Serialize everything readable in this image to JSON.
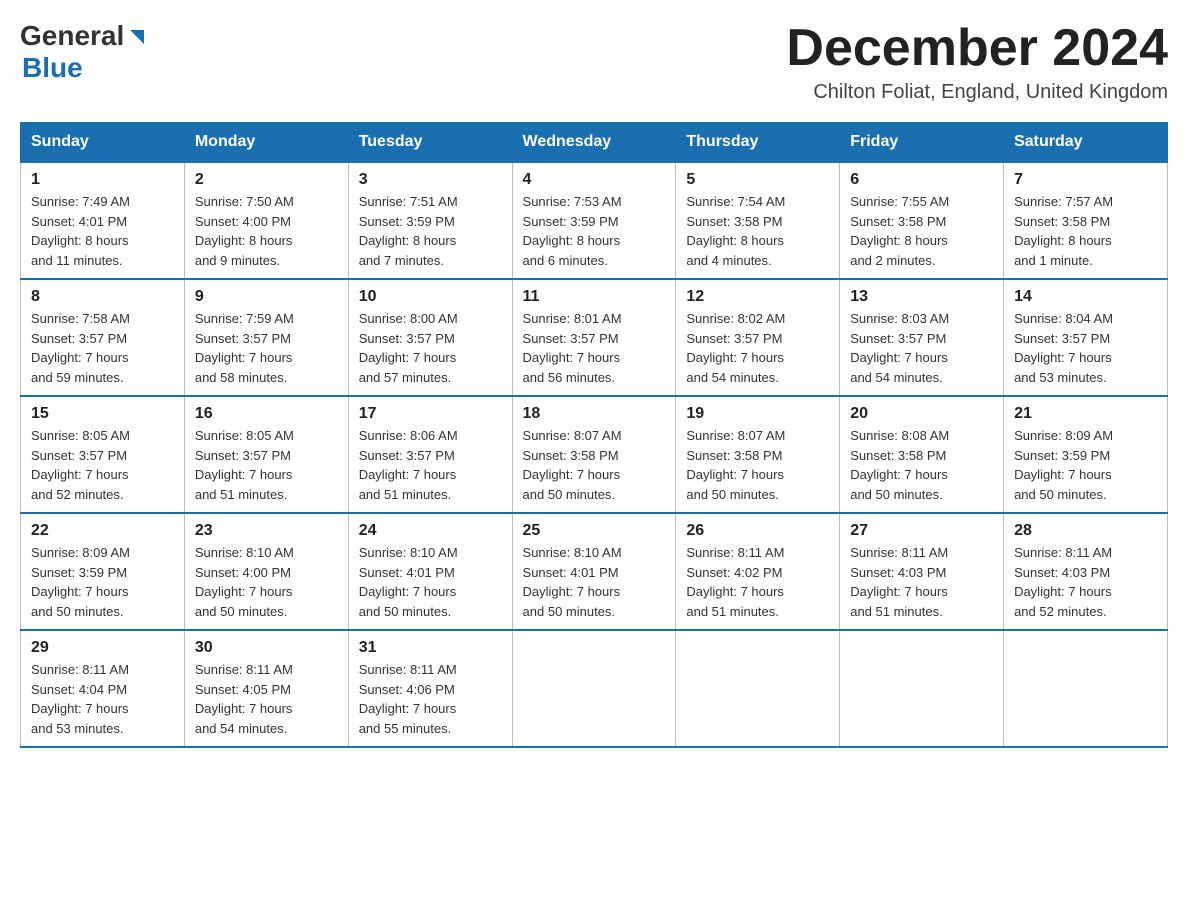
{
  "header": {
    "logo_general": "General",
    "logo_blue": "Blue",
    "month_title": "December 2024",
    "location": "Chilton Foliat, England, United Kingdom"
  },
  "weekdays": [
    "Sunday",
    "Monday",
    "Tuesday",
    "Wednesday",
    "Thursday",
    "Friday",
    "Saturday"
  ],
  "weeks": [
    [
      {
        "day": "1",
        "sunrise": "Sunrise: 7:49 AM",
        "sunset": "Sunset: 4:01 PM",
        "daylight": "Daylight: 8 hours",
        "daylight2": "and 11 minutes."
      },
      {
        "day": "2",
        "sunrise": "Sunrise: 7:50 AM",
        "sunset": "Sunset: 4:00 PM",
        "daylight": "Daylight: 8 hours",
        "daylight2": "and 9 minutes."
      },
      {
        "day": "3",
        "sunrise": "Sunrise: 7:51 AM",
        "sunset": "Sunset: 3:59 PM",
        "daylight": "Daylight: 8 hours",
        "daylight2": "and 7 minutes."
      },
      {
        "day": "4",
        "sunrise": "Sunrise: 7:53 AM",
        "sunset": "Sunset: 3:59 PM",
        "daylight": "Daylight: 8 hours",
        "daylight2": "and 6 minutes."
      },
      {
        "day": "5",
        "sunrise": "Sunrise: 7:54 AM",
        "sunset": "Sunset: 3:58 PM",
        "daylight": "Daylight: 8 hours",
        "daylight2": "and 4 minutes."
      },
      {
        "day": "6",
        "sunrise": "Sunrise: 7:55 AM",
        "sunset": "Sunset: 3:58 PM",
        "daylight": "Daylight: 8 hours",
        "daylight2": "and 2 minutes."
      },
      {
        "day": "7",
        "sunrise": "Sunrise: 7:57 AM",
        "sunset": "Sunset: 3:58 PM",
        "daylight": "Daylight: 8 hours",
        "daylight2": "and 1 minute."
      }
    ],
    [
      {
        "day": "8",
        "sunrise": "Sunrise: 7:58 AM",
        "sunset": "Sunset: 3:57 PM",
        "daylight": "Daylight: 7 hours",
        "daylight2": "and 59 minutes."
      },
      {
        "day": "9",
        "sunrise": "Sunrise: 7:59 AM",
        "sunset": "Sunset: 3:57 PM",
        "daylight": "Daylight: 7 hours",
        "daylight2": "and 58 minutes."
      },
      {
        "day": "10",
        "sunrise": "Sunrise: 8:00 AM",
        "sunset": "Sunset: 3:57 PM",
        "daylight": "Daylight: 7 hours",
        "daylight2": "and 57 minutes."
      },
      {
        "day": "11",
        "sunrise": "Sunrise: 8:01 AM",
        "sunset": "Sunset: 3:57 PM",
        "daylight": "Daylight: 7 hours",
        "daylight2": "and 56 minutes."
      },
      {
        "day": "12",
        "sunrise": "Sunrise: 8:02 AM",
        "sunset": "Sunset: 3:57 PM",
        "daylight": "Daylight: 7 hours",
        "daylight2": "and 54 minutes."
      },
      {
        "day": "13",
        "sunrise": "Sunrise: 8:03 AM",
        "sunset": "Sunset: 3:57 PM",
        "daylight": "Daylight: 7 hours",
        "daylight2": "and 54 minutes."
      },
      {
        "day": "14",
        "sunrise": "Sunrise: 8:04 AM",
        "sunset": "Sunset: 3:57 PM",
        "daylight": "Daylight: 7 hours",
        "daylight2": "and 53 minutes."
      }
    ],
    [
      {
        "day": "15",
        "sunrise": "Sunrise: 8:05 AM",
        "sunset": "Sunset: 3:57 PM",
        "daylight": "Daylight: 7 hours",
        "daylight2": "and 52 minutes."
      },
      {
        "day": "16",
        "sunrise": "Sunrise: 8:05 AM",
        "sunset": "Sunset: 3:57 PM",
        "daylight": "Daylight: 7 hours",
        "daylight2": "and 51 minutes."
      },
      {
        "day": "17",
        "sunrise": "Sunrise: 8:06 AM",
        "sunset": "Sunset: 3:57 PM",
        "daylight": "Daylight: 7 hours",
        "daylight2": "and 51 minutes."
      },
      {
        "day": "18",
        "sunrise": "Sunrise: 8:07 AM",
        "sunset": "Sunset: 3:58 PM",
        "daylight": "Daylight: 7 hours",
        "daylight2": "and 50 minutes."
      },
      {
        "day": "19",
        "sunrise": "Sunrise: 8:07 AM",
        "sunset": "Sunset: 3:58 PM",
        "daylight": "Daylight: 7 hours",
        "daylight2": "and 50 minutes."
      },
      {
        "day": "20",
        "sunrise": "Sunrise: 8:08 AM",
        "sunset": "Sunset: 3:58 PM",
        "daylight": "Daylight: 7 hours",
        "daylight2": "and 50 minutes."
      },
      {
        "day": "21",
        "sunrise": "Sunrise: 8:09 AM",
        "sunset": "Sunset: 3:59 PM",
        "daylight": "Daylight: 7 hours",
        "daylight2": "and 50 minutes."
      }
    ],
    [
      {
        "day": "22",
        "sunrise": "Sunrise: 8:09 AM",
        "sunset": "Sunset: 3:59 PM",
        "daylight": "Daylight: 7 hours",
        "daylight2": "and 50 minutes."
      },
      {
        "day": "23",
        "sunrise": "Sunrise: 8:10 AM",
        "sunset": "Sunset: 4:00 PM",
        "daylight": "Daylight: 7 hours",
        "daylight2": "and 50 minutes."
      },
      {
        "day": "24",
        "sunrise": "Sunrise: 8:10 AM",
        "sunset": "Sunset: 4:01 PM",
        "daylight": "Daylight: 7 hours",
        "daylight2": "and 50 minutes."
      },
      {
        "day": "25",
        "sunrise": "Sunrise: 8:10 AM",
        "sunset": "Sunset: 4:01 PM",
        "daylight": "Daylight: 7 hours",
        "daylight2": "and 50 minutes."
      },
      {
        "day": "26",
        "sunrise": "Sunrise: 8:11 AM",
        "sunset": "Sunset: 4:02 PM",
        "daylight": "Daylight: 7 hours",
        "daylight2": "and 51 minutes."
      },
      {
        "day": "27",
        "sunrise": "Sunrise: 8:11 AM",
        "sunset": "Sunset: 4:03 PM",
        "daylight": "Daylight: 7 hours",
        "daylight2": "and 51 minutes."
      },
      {
        "day": "28",
        "sunrise": "Sunrise: 8:11 AM",
        "sunset": "Sunset: 4:03 PM",
        "daylight": "Daylight: 7 hours",
        "daylight2": "and 52 minutes."
      }
    ],
    [
      {
        "day": "29",
        "sunrise": "Sunrise: 8:11 AM",
        "sunset": "Sunset: 4:04 PM",
        "daylight": "Daylight: 7 hours",
        "daylight2": "and 53 minutes."
      },
      {
        "day": "30",
        "sunrise": "Sunrise: 8:11 AM",
        "sunset": "Sunset: 4:05 PM",
        "daylight": "Daylight: 7 hours",
        "daylight2": "and 54 minutes."
      },
      {
        "day": "31",
        "sunrise": "Sunrise: 8:11 AM",
        "sunset": "Sunset: 4:06 PM",
        "daylight": "Daylight: 7 hours",
        "daylight2": "and 55 minutes."
      },
      null,
      null,
      null,
      null
    ]
  ]
}
